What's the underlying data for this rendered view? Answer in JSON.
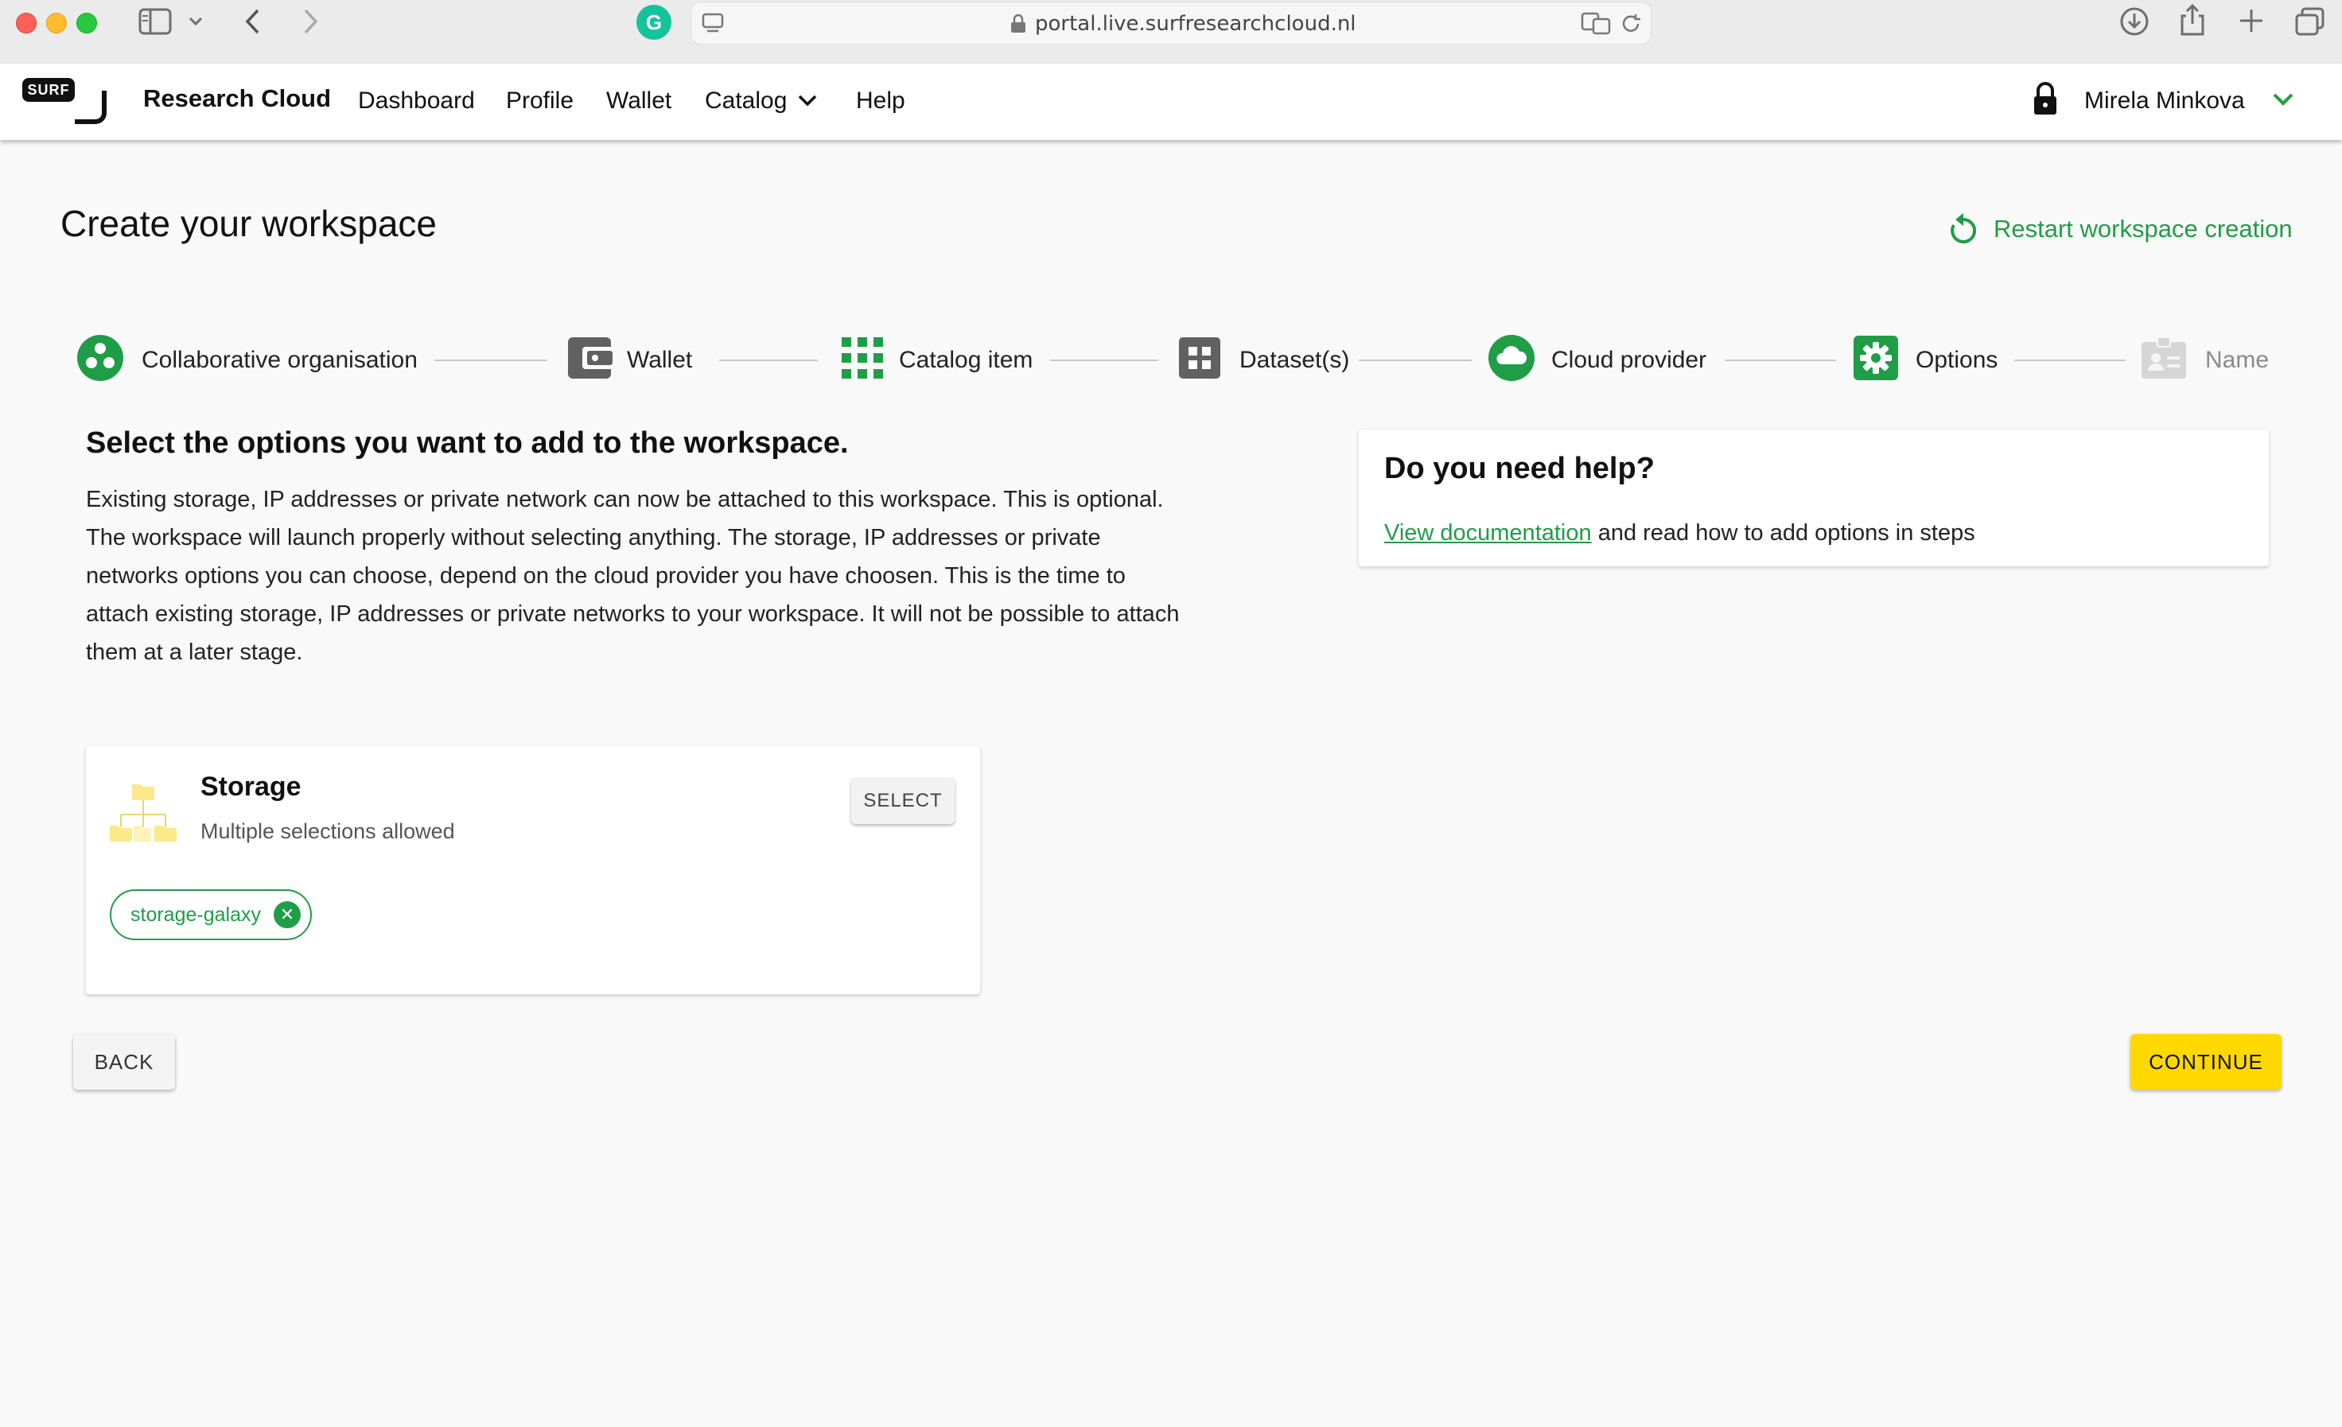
{
  "browser": {
    "url": "portal.live.surfresearchcloud.nl"
  },
  "header": {
    "logo_text": "SURF",
    "brand": "Research Cloud",
    "nav": [
      "Dashboard",
      "Profile",
      "Wallet",
      "Catalog",
      "Help"
    ],
    "user_name": "Mirela Minkova"
  },
  "page": {
    "title": "Create your workspace",
    "restart_label": "Restart workspace creation"
  },
  "stepper": [
    {
      "label": "Collaborative organisation",
      "icon": "group-icon",
      "state": "done"
    },
    {
      "label": "Wallet",
      "icon": "wallet-icon",
      "state": "done"
    },
    {
      "label": "Catalog item",
      "icon": "grid-icon",
      "state": "done"
    },
    {
      "label": "Dataset(s)",
      "icon": "dataset-icon",
      "state": "done"
    },
    {
      "label": "Cloud provider",
      "icon": "cloud-icon",
      "state": "done"
    },
    {
      "label": "Options",
      "icon": "gear-icon",
      "state": "active"
    },
    {
      "label": "Name",
      "icon": "id-card-icon",
      "state": "pending"
    }
  ],
  "options_section": {
    "title": "Select the options you want to add to the workspace.",
    "description": "Existing storage, IP addresses or private network can now be attached to this workspace. This is optional. The workspace will launch properly without selecting anything. The storage, IP addresses or private networks options you can choose, depend on the cloud provider you have choosen. This is the time to attach existing storage, IP addresses or private networks to your workspace. It will not be possible to attach them at a later stage."
  },
  "help": {
    "title": "Do you need help?",
    "link": "View documentation",
    "text": " and read how to add options in steps"
  },
  "storage_card": {
    "title": "Storage",
    "subtitle": "Multiple selections allowed",
    "select_label": "SELECT",
    "selected_chips": [
      "storage-galaxy"
    ]
  },
  "actions": {
    "back": "BACK",
    "continue": "CONTINUE"
  },
  "colors": {
    "accent_green": "#1f9d47",
    "continue_yellow": "#ffd800",
    "step_grey": "#616161"
  }
}
